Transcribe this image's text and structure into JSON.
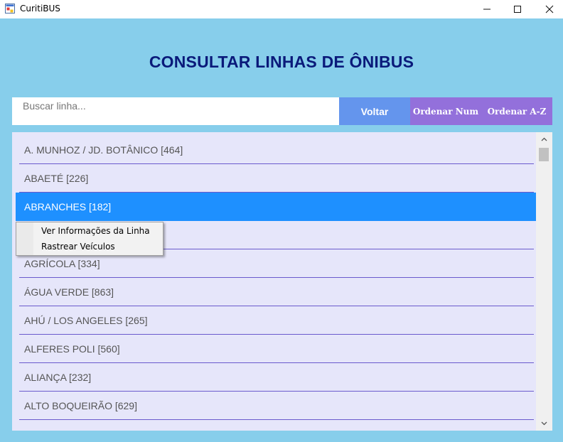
{
  "window": {
    "title": "CuritiBUS",
    "icon": "app-window-icon",
    "minimize_glyph": "—",
    "maximize_glyph": "☐",
    "close_glyph": "✕"
  },
  "header": {
    "title": "CONSULTAR LINHAS DE ÔNIBUS"
  },
  "search": {
    "placeholder": "Buscar linha...",
    "value": ""
  },
  "buttons": {
    "voltar": "Voltar",
    "ordenar_num": "Ordenar Num",
    "ordenar_az": "Ordenar A-Z"
  },
  "lines": [
    {
      "label": "A. MUNHOZ / JD. BOTÂNICO [464]",
      "selected": false
    },
    {
      "label": "ABAETÉ [226]",
      "selected": false
    },
    {
      "label": "ABRANCHES [182]",
      "selected": true
    },
    {
      "label": "",
      "selected": false
    },
    {
      "label": "AGRÍCOLA [334]",
      "selected": false
    },
    {
      "label": "ÁGUA VERDE [863]",
      "selected": false
    },
    {
      "label": "AHÚ / LOS ANGELES [265]",
      "selected": false
    },
    {
      "label": "ALFERES POLI [560]",
      "selected": false
    },
    {
      "label": "ALIANÇA [232]",
      "selected": false
    },
    {
      "label": "ALTO BOQUEIRÃO [629]",
      "selected": false
    }
  ],
  "context_menu": {
    "items": [
      {
        "label": "Ver Informações da Linha"
      },
      {
        "label": "Rastrear Veículos"
      }
    ]
  },
  "colors": {
    "background": "#87CEEB",
    "heading": "#0A1A7A",
    "list_bg": "#E6E6FA",
    "separator": "#6A5ACD",
    "selected_row": "#1E90FF",
    "voltar_button": "#6495ED",
    "sort_buttons": "#9370DB"
  }
}
